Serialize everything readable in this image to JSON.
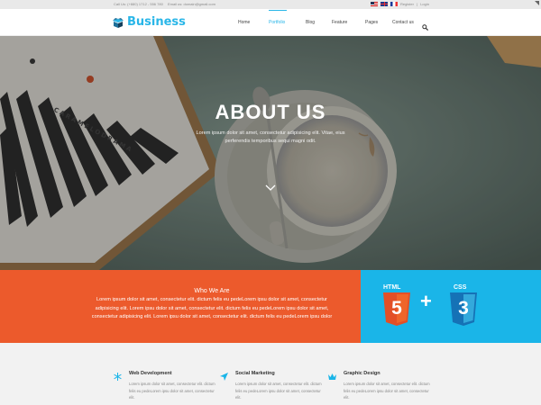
{
  "topbar": {
    "phone": "Call Us: (+880) 1712 - 556 780",
    "email": "Email us: domain@gmail.com",
    "register": "Register",
    "separator": "|",
    "login": "Login"
  },
  "brand": {
    "name": "Business",
    "accent": "#29b6e8"
  },
  "nav": [
    {
      "label": "Home"
    },
    {
      "label": "Portfolio",
      "active": true
    },
    {
      "label": "Blog"
    },
    {
      "label": "Feature"
    },
    {
      "label": "Pages"
    },
    {
      "label": "Contact us"
    }
  ],
  "hero": {
    "title": "ABOUT US",
    "subtitle": "Lorem ipsum dolor sit amet, consectetur adipisicing elit. Vitae, eius perferendis temporibus sequi magni odit.",
    "board_text": "CARAMELODRAMA"
  },
  "who": {
    "heading": "Who We Are",
    "body": "Lorem ipsum dolor sit amet, consectetur elit. dictum felis eu pedeLorem ipsu dolor sit amet, consectetur adipisicing elit. Lorem ipsu dolor sit amet, consectetur elit. dictum felis eu pedeLorem ipsu dolor sit amet, consectetur adipisicing elit.  Lorem ipsu dolor sit amet, consectetur elit. dictum felis eu pedeLorem ipsu dolor",
    "color": "#ec5a2c"
  },
  "tech": {
    "html_label": "HTML",
    "css_label": "CSS",
    "html_digit": "5",
    "css_digit": "3",
    "plus": "+",
    "color": "#1ab5e8"
  },
  "features": [
    {
      "icon": "snowflake-icon",
      "title": "Web Development",
      "text": "Lorem ipsum dolor sit amet, consectetur elit. dictum felis eu pedeLorem ipsu dolor sit amet, consectetur elit."
    },
    {
      "icon": "paper-plane-icon",
      "title": "Social Marketing",
      "text": "Lorem ipsum dolor sit amet, consectetur elit. dictum felis eu pedeLorem ipsu dolor sit amet, consectetur elit."
    },
    {
      "icon": "crown-icon",
      "title": "Graphic Design",
      "text": "Lorem ipsum dolor sit amet, consectetur elit. dictum felis eu pedeLorem ipsu dolor sit amet, consectetur elit."
    }
  ]
}
